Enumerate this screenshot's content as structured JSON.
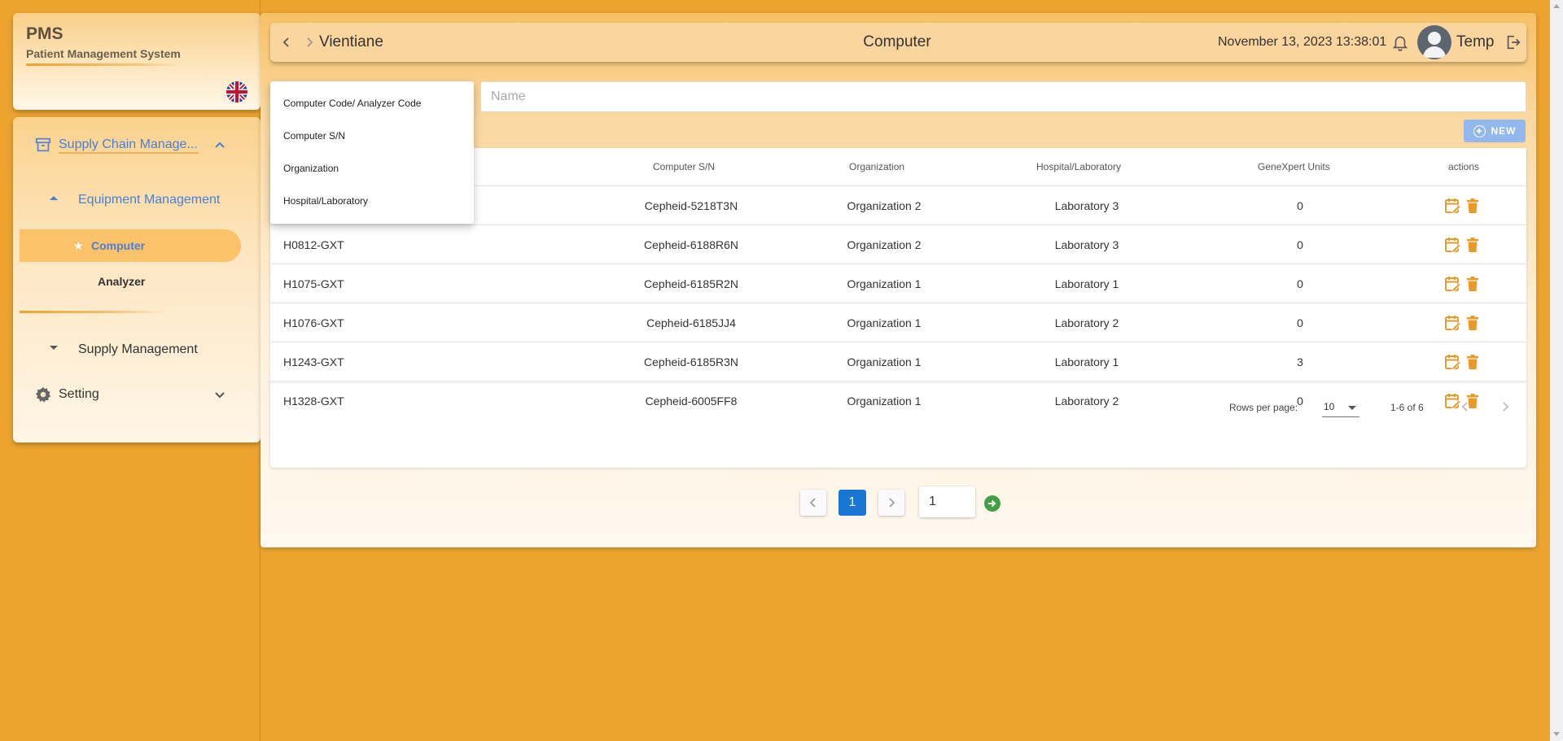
{
  "brand": {
    "title": "PMS",
    "subtitle": "Patient Management System",
    "language_icon": "uk-flag-icon"
  },
  "sidebar": {
    "groups": [
      {
        "label": "Supply Chain Manage...",
        "icon": "archive-box-icon",
        "expanded": true
      },
      {
        "label": "Setting",
        "icon": "gear-icon",
        "expanded": false
      }
    ],
    "subgroups": [
      {
        "label": "Equipment Management",
        "expanded": true
      },
      {
        "label": "Supply Management",
        "expanded": false
      }
    ],
    "items": [
      {
        "label": "Computer",
        "active": true
      },
      {
        "label": "Analyzer",
        "active": false
      }
    ],
    "active_color": "#4a7fd6"
  },
  "topbar": {
    "location": "Vientiane",
    "title": "Computer",
    "datetime": "November 13, 2023 13:38:01",
    "user": "Temp"
  },
  "search": {
    "placeholder": "Name",
    "value": ""
  },
  "filter_menu": {
    "options": [
      "Computer Code/ Analyzer Code",
      "Computer S/N",
      "Organization",
      "Hospital/Laboratory"
    ]
  },
  "toolbar": {
    "new_label": "NEW"
  },
  "table": {
    "columns": [
      "Computer S/N",
      "Organization",
      "Hospital/Laboratory",
      "GeneXpert Units",
      "actions"
    ],
    "rows": [
      {
        "code": "",
        "sn": "Cepheid-5218T3N",
        "org": "Organization 2",
        "lab": "Laboratory 3",
        "units": "0"
      },
      {
        "code": "H0812-GXT",
        "sn": "Cepheid-6188R6N",
        "org": "Organization 2",
        "lab": "Laboratory 3",
        "units": "0"
      },
      {
        "code": "H1075-GXT",
        "sn": "Cepheid-6185R2N",
        "org": "Organization 1",
        "lab": "Laboratory 1",
        "units": "0"
      },
      {
        "code": "H1076-GXT",
        "sn": "Cepheid-6185JJ4",
        "org": "Organization 1",
        "lab": "Laboratory 2",
        "units": "0"
      },
      {
        "code": "H1243-GXT",
        "sn": "Cepheid-6185R3N",
        "org": "Organization 1",
        "lab": "Laboratory 1",
        "units": "3"
      },
      {
        "code": "H1328-GXT",
        "sn": "Cepheid-6005FF8",
        "org": "Organization 1",
        "lab": "Laboratory 2",
        "units": "0"
      }
    ],
    "action_color": "#e99a2c"
  },
  "table_footer": {
    "rows_per_page_label": "Rows per page:",
    "rows_per_page_value": "10",
    "range": "1-6 of 6"
  },
  "pagination": {
    "current_page": "1",
    "page_input": "1"
  }
}
